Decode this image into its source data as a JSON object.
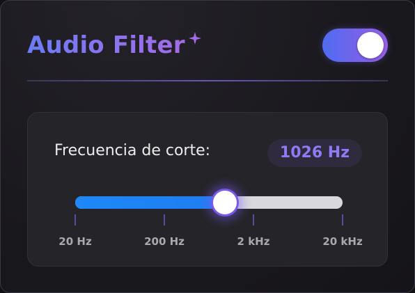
{
  "header": {
    "title": "Audio Filter",
    "sparkle_icon": "sparkle-icon",
    "toggle_on": true
  },
  "cutoff": {
    "label": "Frecuencia de corte:",
    "value_text": "1026 Hz",
    "slider_fraction": 0.56
  },
  "scale": {
    "ticks": [
      {
        "label": "20 Hz"
      },
      {
        "label": "200 Hz"
      },
      {
        "label": "2 kHz"
      },
      {
        "label": "20 kHz"
      }
    ]
  },
  "colors": {
    "accent": "#7b62ea",
    "slider_fill": "#1e88f7",
    "value_text": "#8f7bf5"
  }
}
